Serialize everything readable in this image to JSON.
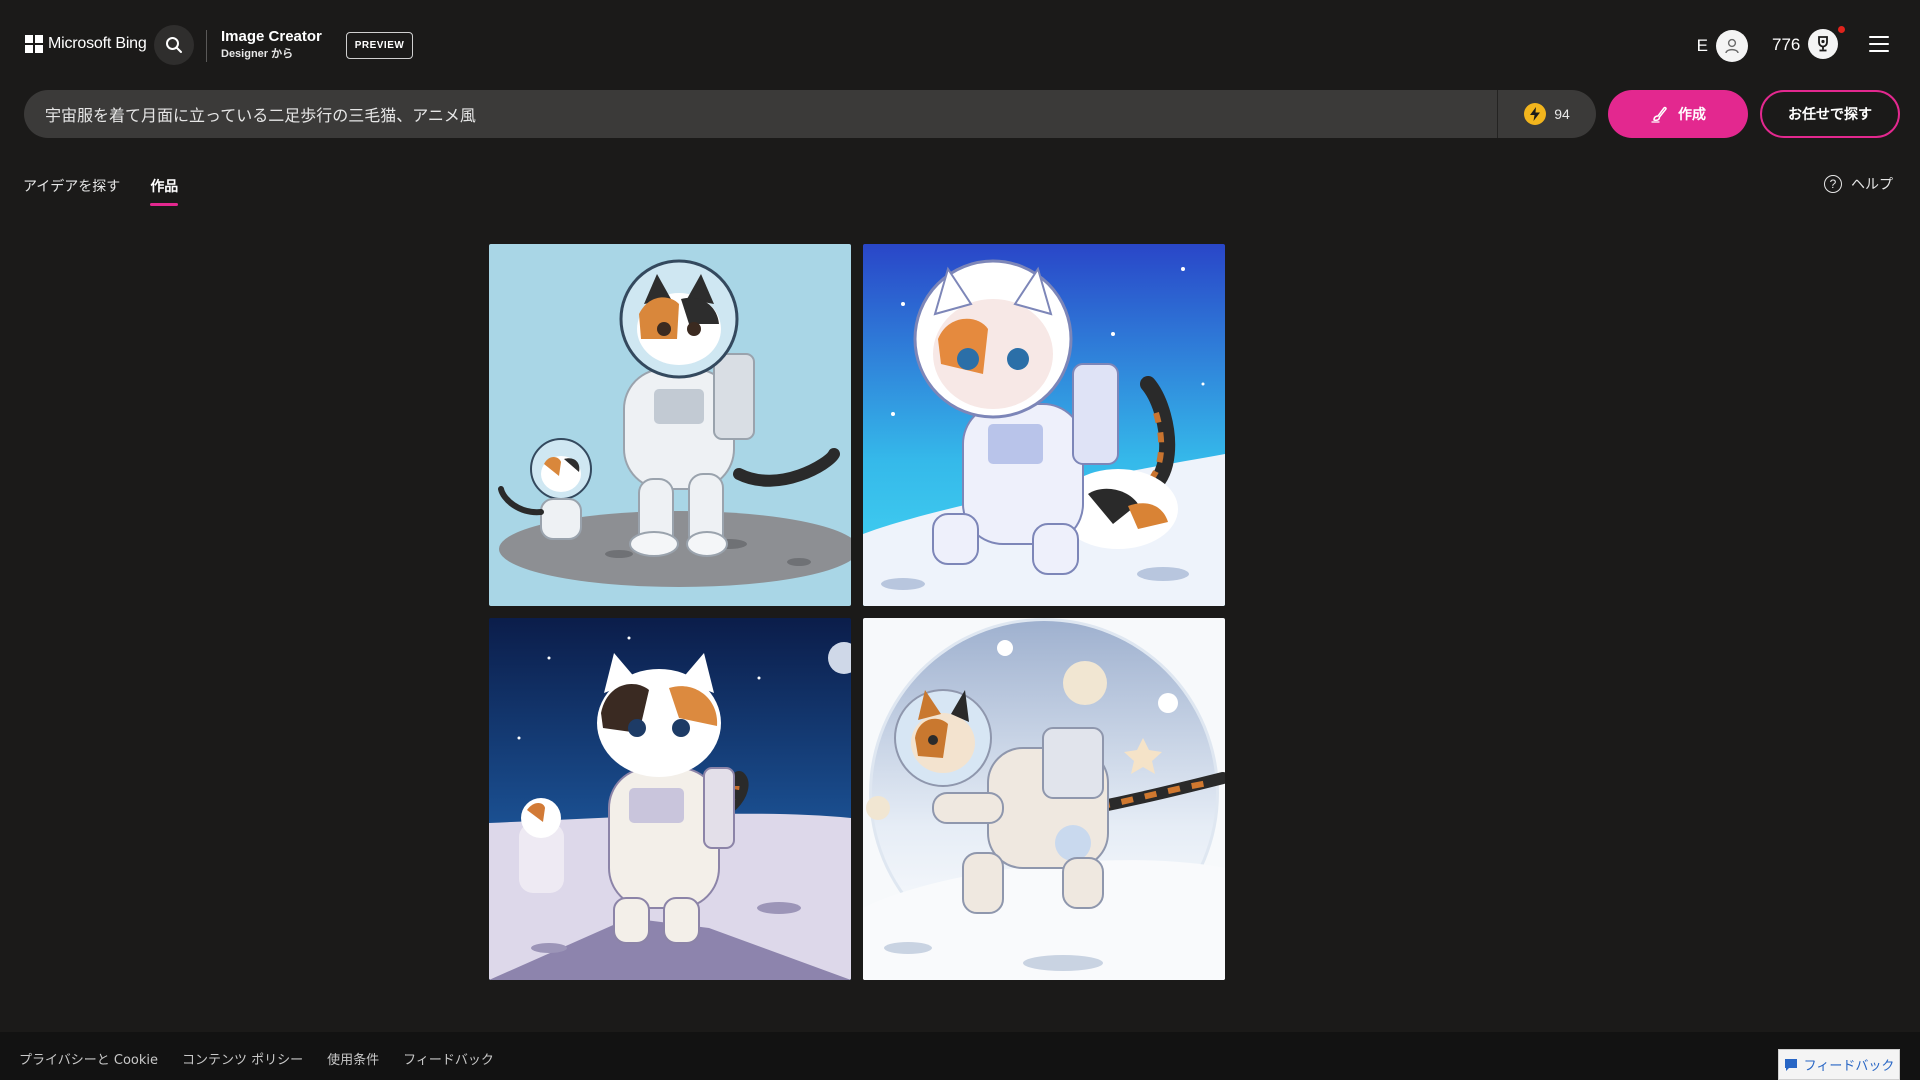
{
  "header": {
    "brand": "Microsoft Bing",
    "product_title": "Image Creator",
    "product_subtitle": "Designer から",
    "badge": "PREVIEW",
    "user_initial": "E",
    "points": "776",
    "icons": [
      "windows-logo",
      "search-icon",
      "user-icon",
      "rewards-trophy-icon",
      "hamburger-menu-icon"
    ]
  },
  "prompt": {
    "value": "宇宙服を着て月面に立っている二足歩行の三毛猫、アニメ風",
    "boosts": "94",
    "create_label": "作成",
    "surprise_label": "お任せで探す"
  },
  "tabs": [
    {
      "label": "アイデアを探す",
      "active": false
    },
    {
      "label": "作品",
      "active": true
    }
  ],
  "help_label": "ヘルプ",
  "images": [
    {
      "alt": "calico-astronaut-cat-1",
      "palette": [
        "#a9d6e6",
        "#f4f6f8",
        "#8c8c8c"
      ]
    },
    {
      "alt": "calico-astronaut-cat-2",
      "palette": [
        "#2f56c9",
        "#e8eef7",
        "#f0f3f8"
      ]
    },
    {
      "alt": "calico-astronaut-cat-3",
      "palette": [
        "#0f2a5a",
        "#d8d4e6",
        "#f3eadf"
      ]
    },
    {
      "alt": "calico-astronaut-cat-4",
      "palette": [
        "#f5f7fa",
        "#dfe8f2",
        "#f6e4cf"
      ]
    }
  ],
  "footer": {
    "links": [
      "プライバシーと Cookie",
      "コンテンツ ポリシー",
      "使用条件",
      "フィードバック"
    ],
    "feedback_button": "フィードバック"
  },
  "colors": {
    "background": "#1b1a19",
    "accent": "#e3288f",
    "prompt_bg": "#3b3a39",
    "footer_bg": "#121212"
  }
}
